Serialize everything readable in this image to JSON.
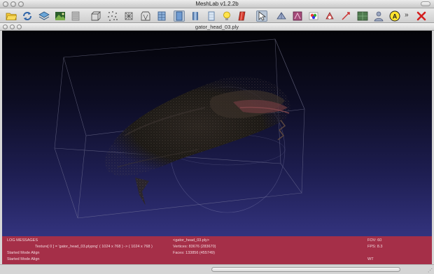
{
  "window": {
    "title": "MeshLab v1.2.2b"
  },
  "toolbar": {
    "buttons": [
      "open-folder",
      "reload",
      "layers",
      "snapshot",
      "stack",
      "bounding-box",
      "points",
      "wireframe",
      "hidden-lines",
      "flat-lines",
      "flat",
      "smooth",
      "light",
      "color-per-vertex",
      "select",
      "select-faces",
      "texture",
      "paint",
      "rgb-color",
      "grid",
      "unknown",
      "person",
      "annotate",
      "close"
    ],
    "overflow": "»"
  },
  "subwindow": {
    "title": "gator_head_03.ply"
  },
  "log": {
    "header": "LOG MESSAGES",
    "texture_line": "Texture[  0 ] =  'gator_head_03.plypng' (  1024 x   768 ) -> (  1024 x   768 )",
    "started_1": "Started Mode Align",
    "started_2": "Started Mode Align"
  },
  "mesh_info": {
    "file": "<gator_head_03.ply>",
    "vertices": "Vertices: 83676 (283670)",
    "faces": "Faces: 133856 (455749)"
  },
  "view_info": {
    "fov": "FOV: 60",
    "fps": "FPS:    8.3",
    "wt": "WT"
  },
  "colors": {
    "log_bg": "#a52f48",
    "viewport_top": "#030307",
    "viewport_bottom": "#33337e"
  }
}
